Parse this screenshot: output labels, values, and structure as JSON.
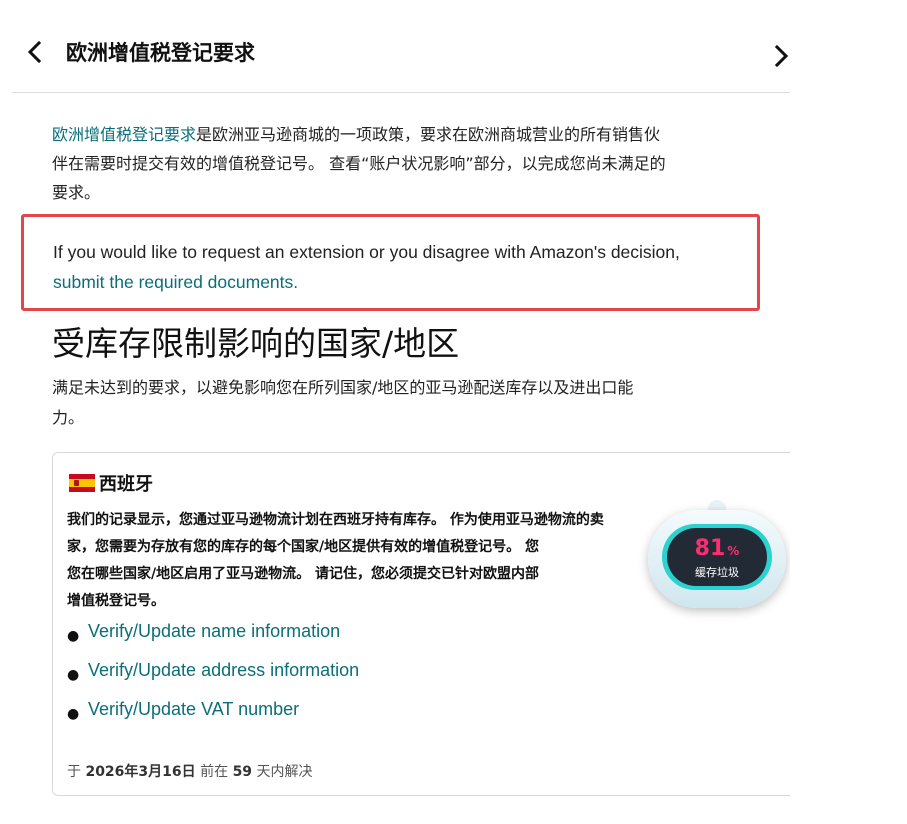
{
  "header": {
    "title": "欧洲增值税登记要求"
  },
  "intro": {
    "link_text": "欧洲增值税登记要求",
    "text_line1": "是欧洲亚马逊商城的一项政策，要求在欧洲商城营业的所有销售伙",
    "text_line2": "伴在需要时提交有效的增值税登记号。 查看“账户状况影响”部分，以完成您尚未满足的",
    "text_line3": "要求。"
  },
  "notice": {
    "text": "If you would like to request an extension or you disagree with Amazon's decision,",
    "link_text": "submit the required documents."
  },
  "section": {
    "title": "受库存限制影响的国家/地区",
    "desc_line1": "满足未达到的要求，以避免影响您在所列国家/地区的亚马逊配送库存以及进出口能",
    "desc_line2": "力。"
  },
  "card": {
    "country": "西班牙",
    "body_lines": [
      "我们的记录显示，您通过亚马逊物流计划在西班牙持有库存。 作为使用亚马逊物流的卖",
      "家，您需要为存放有您的库存的每个国家/地区提供有效的增值税登记号。 您",
      "您在哪些国家/地区启用了亚马逊物流。 请记住，您必须提交已针对欧盟内部",
      "增值税登记号。"
    ],
    "actions": [
      "Verify/Update name information",
      "Verify/Update address information",
      "Verify/Update VAT number"
    ],
    "deadline": {
      "prefix": "于",
      "date": "2026年3月16日",
      "middle": "前在",
      "days": "59",
      "suffix": "天内解决"
    }
  },
  "widget": {
    "value": "81",
    "unit": "%",
    "label": "缓存垃圾",
    "value_color": "#ff2d70"
  },
  "colors": {
    "link": "#0b6e79",
    "highlight_border": "#e3464a"
  },
  "icons": {
    "back": "chevron-left-icon",
    "forward": "chevron-right-icon",
    "flag": "spain-flag-icon"
  }
}
